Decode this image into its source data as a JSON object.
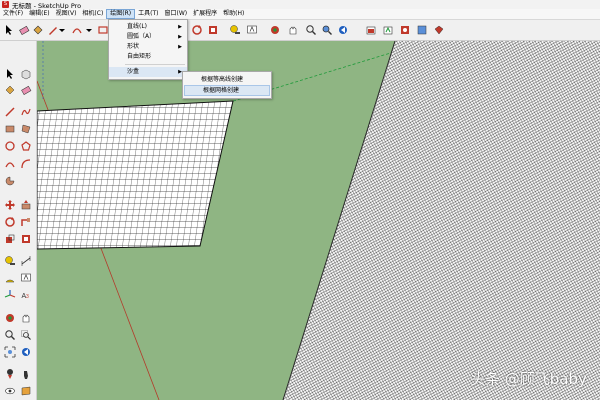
{
  "window": {
    "title": "无标题 - SketchUp Pro"
  },
  "menubar": {
    "items": [
      "文件(F)",
      "编辑(E)",
      "视图(V)",
      "相机(C)",
      "绘图(R)",
      "工具(T)",
      "窗口(W)",
      "扩展程序",
      "帮助(H)"
    ],
    "active_index": 4
  },
  "draw_menu": {
    "items": [
      {
        "label": "直线(L)",
        "has_submenu": true
      },
      {
        "label": "圆弧（A）",
        "has_submenu": true
      },
      {
        "label": "形状",
        "has_submenu": true
      },
      {
        "label": "自由矩形",
        "has_submenu": false
      },
      {
        "label": "沙盒",
        "has_submenu": true
      }
    ],
    "active_index": 4
  },
  "sandbox_submenu": {
    "items": [
      "根据等高线创建",
      "根据网格创建"
    ],
    "highlight_index": 1
  },
  "watermark": {
    "text": "头条 @顾飞baby"
  },
  "colors": {
    "viewport_background": "#8fb583",
    "menu_highlight": "#dbe7f4",
    "mesh_lines": "#222222",
    "axis_red": "#b33a2a",
    "axis_green": "#1f9a3a"
  }
}
